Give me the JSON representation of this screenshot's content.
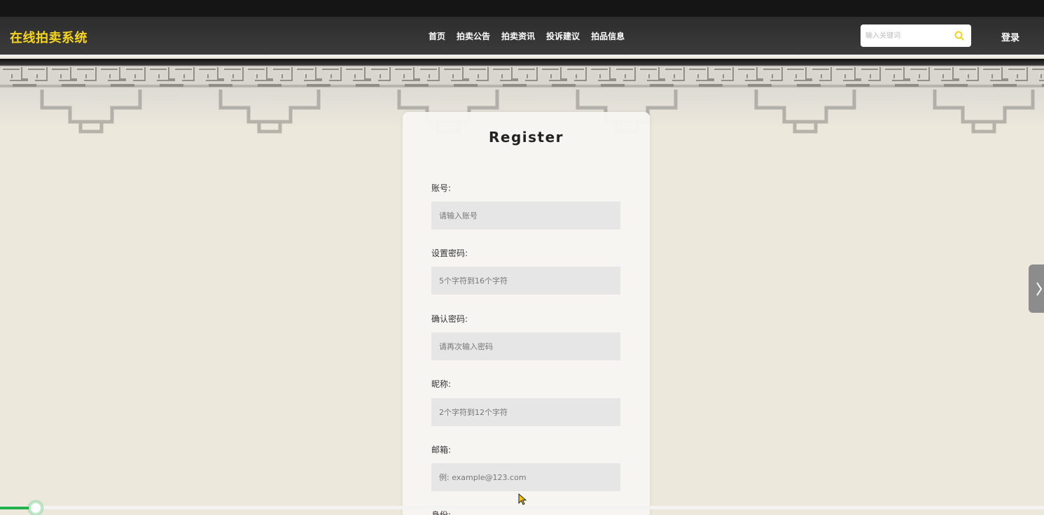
{
  "colors": {
    "brand": "#f7d51d",
    "accent": "#22b14c",
    "nav_bg": "#3a3a3a"
  },
  "header": {
    "brand": "在线拍卖系统",
    "nav": [
      "首页",
      "拍卖公告",
      "拍卖资讯",
      "投诉建议",
      "拍品信息"
    ],
    "search": {
      "placeholder": "输入关键词",
      "icon": "search-icon"
    },
    "login": "登录"
  },
  "register": {
    "title": "Register",
    "fields": [
      {
        "label": "账号:",
        "placeholder": "请输入账号"
      },
      {
        "label": "设置密码:",
        "placeholder": "5个字符到16个字符"
      },
      {
        "label": "确认密码:",
        "placeholder": "请再次输入密码"
      },
      {
        "label": "昵称:",
        "placeholder": "2个字符到12个字符"
      },
      {
        "label": "邮箱:",
        "placeholder": "例: example@123.com"
      },
      {
        "label": "身份:"
      }
    ]
  },
  "carousel": {
    "next_icon": "chevron-right-icon"
  },
  "video_progress": {
    "fraction": 0.034
  }
}
